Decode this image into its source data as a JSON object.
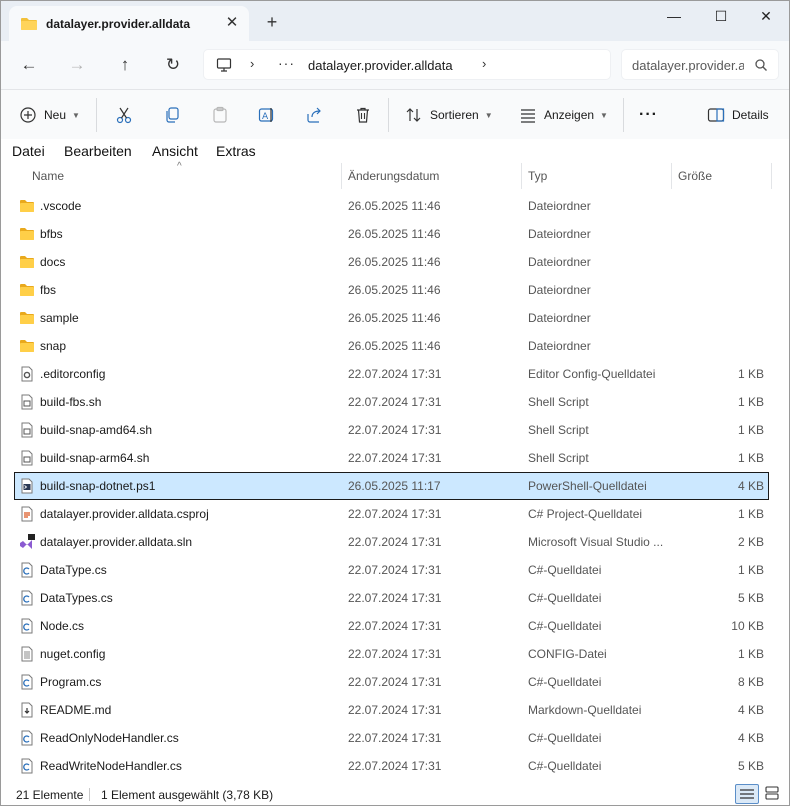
{
  "window": {
    "tab_title": "datalayer.provider.alldata",
    "tab_close": "✕",
    "new_tab": "+",
    "minimize": "—",
    "maximize": "☐",
    "close": "✕"
  },
  "nav": {
    "back": "←",
    "forward": "→",
    "up": "↑",
    "refresh": "↻",
    "breadcrumb_more": "···",
    "breadcrumb": "datalayer.provider.alldata",
    "search_placeholder": "datalayer.provider.alldata durchsuchen"
  },
  "toolbar": {
    "new_label": "Neu",
    "sort_label": "Sortieren",
    "view_label": "Anzeigen",
    "more_label": "···",
    "details_label": "Details"
  },
  "menu": [
    "Datei",
    "Bearbeiten",
    "Ansicht",
    "Extras"
  ],
  "columns": {
    "name": "Name",
    "modified": "Änderungsdatum",
    "type": "Typ",
    "size": "Größe"
  },
  "files": [
    {
      "name": ".vscode",
      "modified": "26.05.2025 11:46",
      "type": "Dateiordner",
      "size": "",
      "icon": "folder-icon"
    },
    {
      "name": "bfbs",
      "modified": "26.05.2025 11:46",
      "type": "Dateiordner",
      "size": "",
      "icon": "folder-icon"
    },
    {
      "name": "docs",
      "modified": "26.05.2025 11:46",
      "type": "Dateiordner",
      "size": "",
      "icon": "folder-icon"
    },
    {
      "name": "fbs",
      "modified": "26.05.2025 11:46",
      "type": "Dateiordner",
      "size": "",
      "icon": "folder-icon"
    },
    {
      "name": "sample",
      "modified": "26.05.2025 11:46",
      "type": "Dateiordner",
      "size": "",
      "icon": "folder-icon"
    },
    {
      "name": "snap",
      "modified": "26.05.2025 11:46",
      "type": "Dateiordner",
      "size": "",
      "icon": "folder-icon"
    },
    {
      "name": ".editorconfig",
      "modified": "22.07.2024 17:31",
      "type": "Editor Config-Quelldatei",
      "size": "1 KB",
      "icon": "config-gear-file-icon"
    },
    {
      "name": "build-fbs.sh",
      "modified": "22.07.2024 17:31",
      "type": "Shell Script",
      "size": "1 KB",
      "icon": "shell-script-file-icon"
    },
    {
      "name": "build-snap-amd64.sh",
      "modified": "22.07.2024 17:31",
      "type": "Shell Script",
      "size": "1 KB",
      "icon": "shell-script-file-icon"
    },
    {
      "name": "build-snap-arm64.sh",
      "modified": "22.07.2024 17:31",
      "type": "Shell Script",
      "size": "1 KB",
      "icon": "shell-script-file-icon"
    },
    {
      "name": "build-snap-dotnet.ps1",
      "modified": "26.05.2025 11:17",
      "type": "PowerShell-Quelldatei",
      "size": "4 KB",
      "icon": "powershell-file-icon",
      "selected": true
    },
    {
      "name": "datalayer.provider.alldata.csproj",
      "modified": "22.07.2024 17:31",
      "type": "C# Project-Quelldatei",
      "size": "1 KB",
      "icon": "csproj-file-icon"
    },
    {
      "name": "datalayer.provider.alldata.sln",
      "modified": "22.07.2024 17:31",
      "type": "Microsoft Visual Studio ...",
      "size": "2 KB",
      "icon": "visual-studio-solution-icon"
    },
    {
      "name": "DataType.cs",
      "modified": "22.07.2024 17:31",
      "type": "C#-Quelldatei",
      "size": "1 KB",
      "icon": "csharp-file-icon"
    },
    {
      "name": "DataTypes.cs",
      "modified": "22.07.2024 17:31",
      "type": "C#-Quelldatei",
      "size": "5 KB",
      "icon": "csharp-file-icon"
    },
    {
      "name": "Node.cs",
      "modified": "22.07.2024 17:31",
      "type": "C#-Quelldatei",
      "size": "10 KB",
      "icon": "csharp-file-icon"
    },
    {
      "name": "nuget.config",
      "modified": "22.07.2024 17:31",
      "type": "CONFIG-Datei",
      "size": "1 KB",
      "icon": "text-file-icon"
    },
    {
      "name": "Program.cs",
      "modified": "22.07.2024 17:31",
      "type": "C#-Quelldatei",
      "size": "8 KB",
      "icon": "csharp-file-icon"
    },
    {
      "name": "README.md",
      "modified": "22.07.2024 17:31",
      "type": "Markdown-Quelldatei",
      "size": "4 KB",
      "icon": "markdown-file-icon"
    },
    {
      "name": "ReadOnlyNodeHandler.cs",
      "modified": "22.07.2024 17:31",
      "type": "C#-Quelldatei",
      "size": "4 KB",
      "icon": "csharp-file-icon"
    },
    {
      "name": "ReadWriteNodeHandler.cs",
      "modified": "22.07.2024 17:31",
      "type": "C#-Quelldatei",
      "size": "5 KB",
      "icon": "csharp-file-icon"
    }
  ],
  "status": {
    "count": "21 Elemente",
    "selection": "1 Element ausgewählt (3,78 KB)"
  },
  "colors": {
    "selection": "#cce8ff",
    "folder": "#f3c13a",
    "accent": "#0067c0"
  }
}
